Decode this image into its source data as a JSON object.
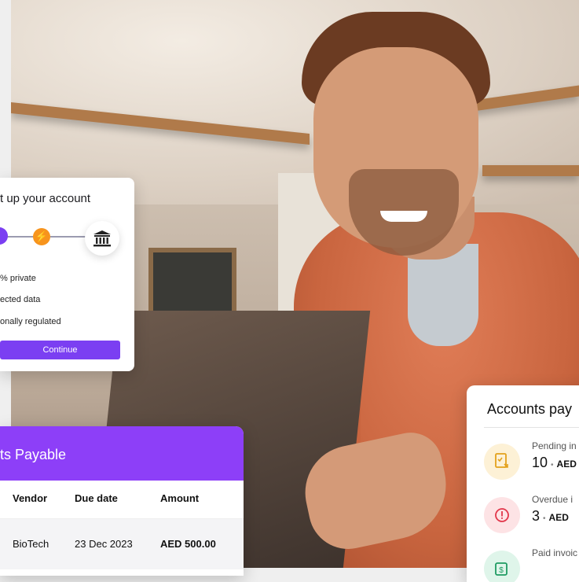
{
  "setup_card": {
    "title": "t up your account",
    "features": [
      "% private",
      "ected data",
      "onally regulated"
    ],
    "continue_label": "Continue",
    "colors": {
      "accent": "#7b3ff2",
      "step_bolt": "#f7941d"
    },
    "icons": [
      "step-active-icon",
      "bolt-icon",
      "bank-icon"
    ]
  },
  "payable_table": {
    "title": "ts Payable",
    "header_color": "#8d3ff8",
    "columns": [
      "Vendor",
      "Due date",
      "Amount"
    ],
    "rows": [
      {
        "vendor": "BioTech",
        "due_date": "23 Dec 2023",
        "amount": "AED 500.00"
      }
    ]
  },
  "summary_card": {
    "title": "Accounts pay",
    "items": [
      {
        "label": "Pending in",
        "count": "10",
        "currency": "AED",
        "icon": "pending-invoice-icon",
        "icon_bg": "#fdf1d6"
      },
      {
        "label": "Overdue i",
        "count": "3",
        "currency": "AED",
        "icon": "alert-icon",
        "icon_bg": "#fde3e5"
      },
      {
        "label": "Paid invoic",
        "count": "",
        "currency": "",
        "icon": "paid-invoice-icon",
        "icon_bg": "#dff5ea"
      }
    ]
  }
}
